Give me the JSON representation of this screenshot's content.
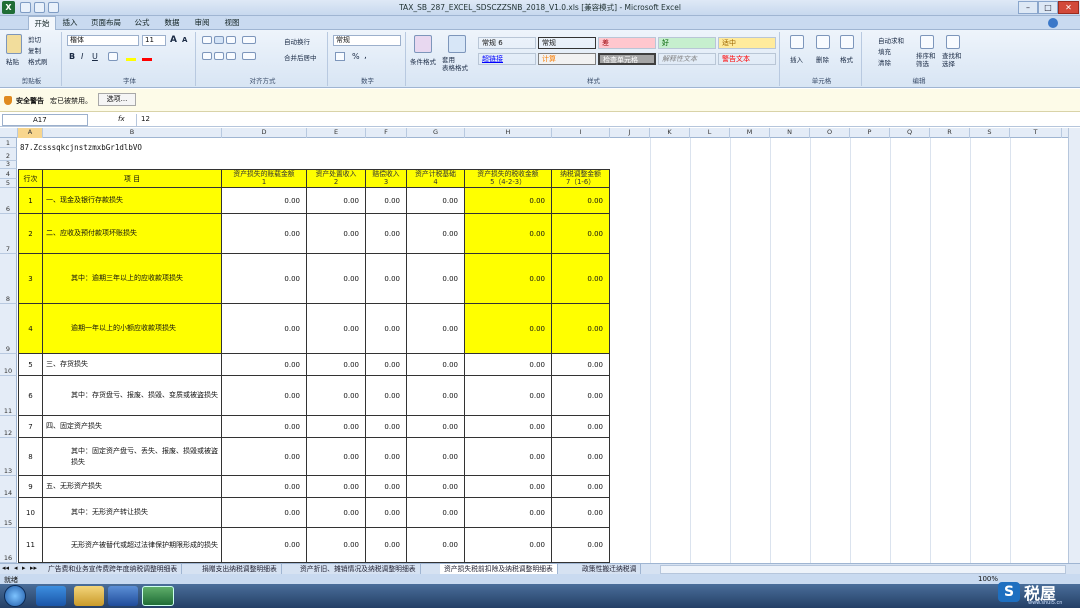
{
  "window": {
    "title": "TAX_SB_287_EXCEL_SDSCZZSNB_2018_V1.0.xls [兼容模式] - Microsoft Excel",
    "min": "–",
    "max": "□",
    "close": "✕"
  },
  "ribbon_tabs": [
    "开始",
    "插入",
    "页面布局",
    "公式",
    "数据",
    "审阅",
    "视图"
  ],
  "ribbon": {
    "clipboard": {
      "paste": "粘贴",
      "cut": "剪切",
      "copy": "复制",
      "format_painter": "格式刷",
      "label": "剪贴板"
    },
    "font": {
      "name": "楷体",
      "size": "11",
      "grow": "A",
      "shrink": "A",
      "bold": "B",
      "italic": "I",
      "underline": "U",
      "label": "字体"
    },
    "alignment": {
      "wrap": "自动换行",
      "merge": "合并后居中",
      "label": "对齐方式"
    },
    "number": {
      "format": "常规",
      "currency": "%",
      "comma": ",",
      "label": "数字"
    },
    "styles": {
      "conditional": "条件格式",
      "table": "套用\n表格格式",
      "cells": [
        {
          "text": "常规 6",
          "bg": "#ffffff",
          "color": "#000000"
        },
        {
          "text": "常规",
          "bg": "#ffffff",
          "color": "#000000"
        },
        {
          "text": "差",
          "bg": "#ffc7ce",
          "color": "#9c0006"
        },
        {
          "text": "好",
          "bg": "#c6efce",
          "color": "#006100"
        },
        {
          "text": "适中",
          "bg": "#ffeb9c",
          "color": "#9c6500"
        },
        {
          "text": "超链接",
          "bg": "#ffffff",
          "color": "#0000ff"
        },
        {
          "text": "计算",
          "bg": "#f2f2f2",
          "color": "#fa7d00"
        },
        {
          "text": "检查单元格",
          "bg": "#a5a5a5",
          "color": "#ffffff"
        },
        {
          "text": "解释性文本",
          "bg": "#ffffff",
          "color": "#7f7f7f"
        },
        {
          "text": "警告文本",
          "bg": "#ffffff",
          "color": "#ff0000"
        }
      ],
      "label": "样式"
    },
    "cells": {
      "insert": "插入",
      "delete": "删除",
      "format": "格式",
      "label": "单元格"
    },
    "editing": {
      "autosum": "自动求和",
      "fill": "填充",
      "clear": "清除",
      "sort": "排序和\n筛选",
      "find": "查找和\n选择",
      "label": "编辑"
    }
  },
  "security": {
    "title": "安全警告",
    "message": "宏已被禁用。",
    "options": "选项..."
  },
  "formula_bar": {
    "name_box": "A17",
    "fx": "fx",
    "value": "12"
  },
  "columns": [
    "A",
    "B",
    "D",
    "E",
    "F",
    "G",
    "H",
    "I",
    "J",
    "K",
    "L",
    "M",
    "N",
    "O",
    "P",
    "Q",
    "R",
    "S",
    "T"
  ],
  "row_numbers": [
    "1",
    "2",
    "3",
    "4",
    "5",
    "6",
    "7",
    "8",
    "9",
    "10",
    "11",
    "12",
    "13",
    "14",
    "15",
    "16"
  ],
  "sheet": {
    "id_text": "87.ZcsssqkcjnstzmxbGr1dlbVO",
    "header": {
      "seq": "行次",
      "item": "项 目",
      "cols": [
        {
          "title": "资产损失的账载金额",
          "num": "1"
        },
        {
          "title": "资产处置收入",
          "num": "2"
        },
        {
          "title": "赔偿收入",
          "num": "3"
        },
        {
          "title": "资产计税基础",
          "num": "4"
        },
        {
          "title": "资产损失的税收金额",
          "num": "5（4-2-3）"
        },
        {
          "title": "纳税调整金额",
          "num": "7（1-6）"
        }
      ]
    },
    "rows": [
      {
        "seq": "1",
        "item": "一、现金及银行存款损失",
        "values": [
          "0.00",
          "0.00",
          "0.00",
          "0.00",
          "0.00",
          "0.00"
        ]
      },
      {
        "seq": "2",
        "item": "二、应收及预付款项坏账损失",
        "values": [
          "0.00",
          "0.00",
          "0.00",
          "0.00",
          "0.00",
          "0.00"
        ]
      },
      {
        "seq": "3",
        "item": "其中：逾期三年以上的应收款项损失",
        "values": [
          "0.00",
          "0.00",
          "0.00",
          "0.00",
          "0.00",
          "0.00"
        ]
      },
      {
        "seq": "4",
        "item": "逾期一年以上的小额应收款项损失",
        "values": [
          "0.00",
          "0.00",
          "0.00",
          "0.00",
          "0.00",
          "0.00"
        ]
      },
      {
        "seq": "5",
        "item": "三、存货损失",
        "values": [
          "0.00",
          "0.00",
          "0.00",
          "0.00",
          "0.00",
          "0.00"
        ]
      },
      {
        "seq": "6",
        "item": "其中：存货盘亏、报废、损毁、变质或被盗损失",
        "values": [
          "0.00",
          "0.00",
          "0.00",
          "0.00",
          "0.00",
          "0.00"
        ]
      },
      {
        "seq": "7",
        "item": "四、固定资产损失",
        "values": [
          "0.00",
          "0.00",
          "0.00",
          "0.00",
          "0.00",
          "0.00"
        ]
      },
      {
        "seq": "8",
        "item": "其中：固定资产盘亏、丢失、报废、损毁或被盗损失",
        "values": [
          "0.00",
          "0.00",
          "0.00",
          "0.00",
          "0.00",
          "0.00"
        ]
      },
      {
        "seq": "9",
        "item": "五、无形资产损失",
        "values": [
          "0.00",
          "0.00",
          "0.00",
          "0.00",
          "0.00",
          "0.00"
        ]
      },
      {
        "seq": "10",
        "item": "其中：无形资产转让损失",
        "values": [
          "0.00",
          "0.00",
          "0.00",
          "0.00",
          "0.00",
          "0.00"
        ]
      },
      {
        "seq": "11",
        "item": "无形资产被替代或超过法律保护期限形成的损失",
        "values": [
          "0.00",
          "0.00",
          "0.00",
          "0.00",
          "0.00",
          "0.00"
        ]
      }
    ]
  },
  "sheet_tabs": [
    "广告费和业务宣传费跨年度纳税调整明细表",
    "捐赠支出纳税调整明细表",
    "资产折旧、摊销情况及纳税调整明细表",
    "资产损失税前扣除及纳税调整明细表",
    "政策性搬迁纳税调"
  ],
  "status": {
    "ready": "就绪",
    "zoom": "100%"
  },
  "watermark": {
    "text": "税屋",
    "sub": "www.shui5.cn"
  },
  "colors": {
    "yellow": "#ffff00",
    "ribbon": "#d8e5f4",
    "taskbar": "#243f66"
  }
}
